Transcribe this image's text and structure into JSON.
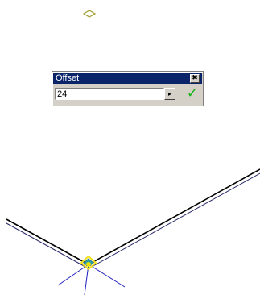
{
  "dialog": {
    "title": "Offset",
    "close_glyph": "✖",
    "value": "24",
    "dropdown_glyph": "▸",
    "ok_glyph": "✓"
  },
  "icons": [
    "diamond-marker-icon",
    "close-icon",
    "dropdown-arrow-icon",
    "checkmark-icon",
    "snap-point-icon"
  ],
  "colors": {
    "titlebar": "#0a246a",
    "dialog_face": "#d4d0c8",
    "wall_line": "#000000",
    "guide_line": "#2020c0",
    "marker": "#a0a030",
    "snap_highlight": "#f0e020",
    "ok_check": "#19b219"
  }
}
